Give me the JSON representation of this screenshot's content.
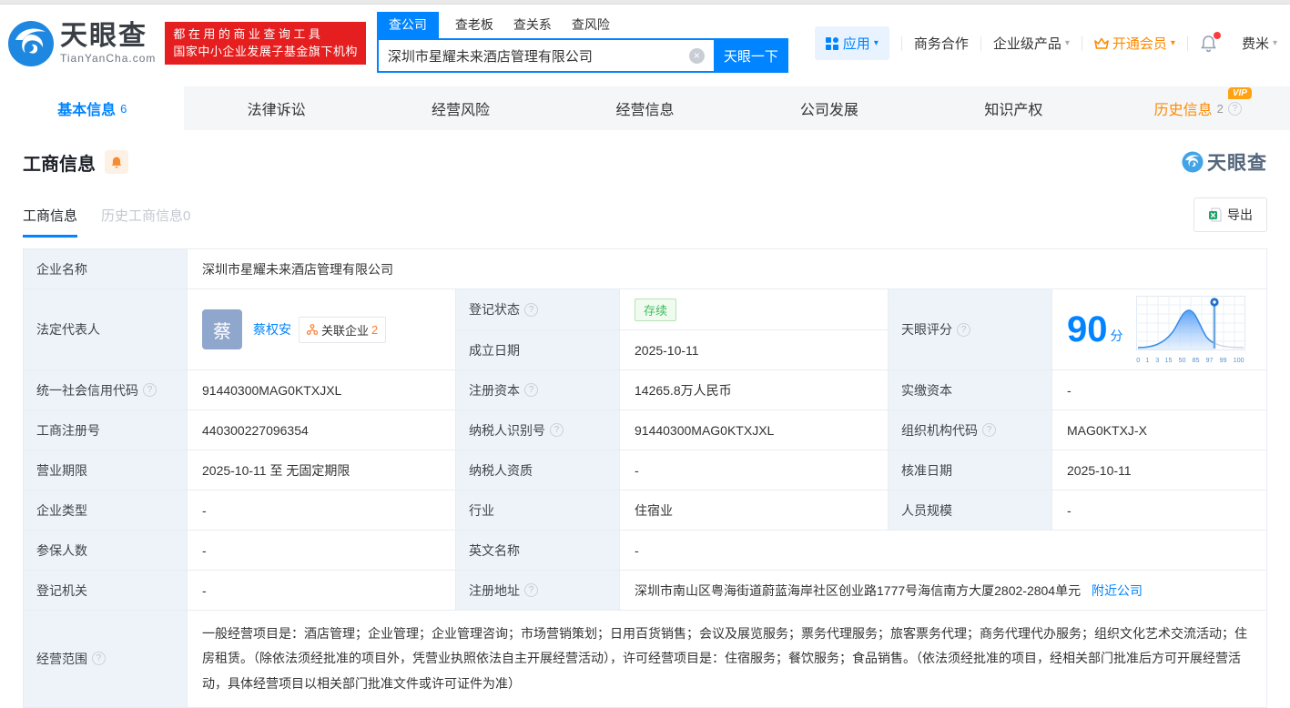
{
  "icons": {
    "help": "?",
    "caret": "▾",
    "clear": "×"
  },
  "colors": {
    "accent": "#0084ff",
    "brand_red": "#e51f1f",
    "vip_orange": "#ff8a00",
    "status_green": "#3dbd5b"
  },
  "header": {
    "logo_text": "天眼查",
    "logo_domain": "TianYanCha.com",
    "slogan_line1": "都在用的商业查询工具",
    "slogan_line2": "国家中小企业发展子基金旗下机构",
    "search_tabs": [
      "查公司",
      "查老板",
      "查关系",
      "查风险"
    ],
    "search_value": "深圳市星耀未来酒店管理有限公司",
    "search_button": "天眼一下",
    "nav_apps": "应用",
    "nav_cooperation": "商务合作",
    "nav_enterprise": "企业级产品",
    "nav_vip": "开通会员",
    "nav_username": "费米"
  },
  "tabs": [
    {
      "label": "基本信息",
      "count": "6"
    },
    {
      "label": "法律诉讼"
    },
    {
      "label": "经营风险"
    },
    {
      "label": "经营信息"
    },
    {
      "label": "公司发展"
    },
    {
      "label": "知识产权"
    },
    {
      "label": "历史信息",
      "count": "2",
      "vip": "VIP"
    }
  ],
  "section": {
    "title": "工商信息",
    "watermark": "天眼查",
    "subtab_active": "工商信息",
    "subtab_history": "历史工商信息0",
    "export_label": "导出"
  },
  "fields": {
    "company_name": {
      "label": "企业名称",
      "value": "深圳市星耀未来酒店管理有限公司"
    },
    "legal_rep": {
      "label": "法定代表人",
      "avatar": "蔡",
      "name": "蔡权安",
      "related_label": "关联企业",
      "related_count": "2"
    },
    "reg_status": {
      "label": "登记状态",
      "value": "存续"
    },
    "establish_date": {
      "label": "成立日期",
      "value": "2025-10-11"
    },
    "score": {
      "label": "天眼评分",
      "value": "90",
      "unit": "分",
      "axis": [
        "0",
        "1",
        "3",
        "15",
        "50",
        "85",
        "97",
        "99",
        "100"
      ]
    },
    "credit_code": {
      "label": "统一社会信用代码",
      "value": "91440300MAG0KTXJXL"
    },
    "reg_capital": {
      "label": "注册资本",
      "value": "14265.8万人民币"
    },
    "paid_capital": {
      "label": "实缴资本",
      "value": "-"
    },
    "reg_number": {
      "label": "工商注册号",
      "value": "440300227096354"
    },
    "taxpayer_id": {
      "label": "纳税人识别号",
      "value": "91440300MAG0KTXJXL"
    },
    "org_code": {
      "label": "组织机构代码",
      "value": "MAG0KTXJ-X"
    },
    "business_term": {
      "label": "营业期限",
      "value": "2025-10-11 至 无固定期限"
    },
    "taxpayer_quality": {
      "label": "纳税人资质",
      "value": "-"
    },
    "approval_date": {
      "label": "核准日期",
      "value": "2025-10-11"
    },
    "company_type": {
      "label": "企业类型",
      "value": "-"
    },
    "industry": {
      "label": "行业",
      "value": "住宿业"
    },
    "staff_size": {
      "label": "人员规模",
      "value": "-"
    },
    "insured_count": {
      "label": "参保人数",
      "value": "-"
    },
    "english_name": {
      "label": "英文名称",
      "value": "-"
    },
    "reg_authority": {
      "label": "登记机关",
      "value": "-"
    },
    "reg_address": {
      "label": "注册地址",
      "value": "深圳市南山区粤海街道蔚蓝海岸社区创业路1777号海信南方大厦2802-2804单元",
      "nearby_link": "附近公司"
    },
    "business_scope": {
      "label": "经营范围",
      "value": "一般经营项目是：酒店管理；企业管理；企业管理咨询；市场营销策划；日用百货销售；会议及展览服务；票务代理服务；旅客票务代理；商务代理代办服务；组织文化艺术交流活动；住房租赁。（除依法须经批准的项目外，凭营业执照依法自主开展经营活动），许可经营项目是：住宿服务；餐饮服务；食品销售。（依法须经批准的项目，经相关部门批准后方可开展经营活动，具体经营项目以相关部门批准文件或许可证件为准）"
    }
  }
}
